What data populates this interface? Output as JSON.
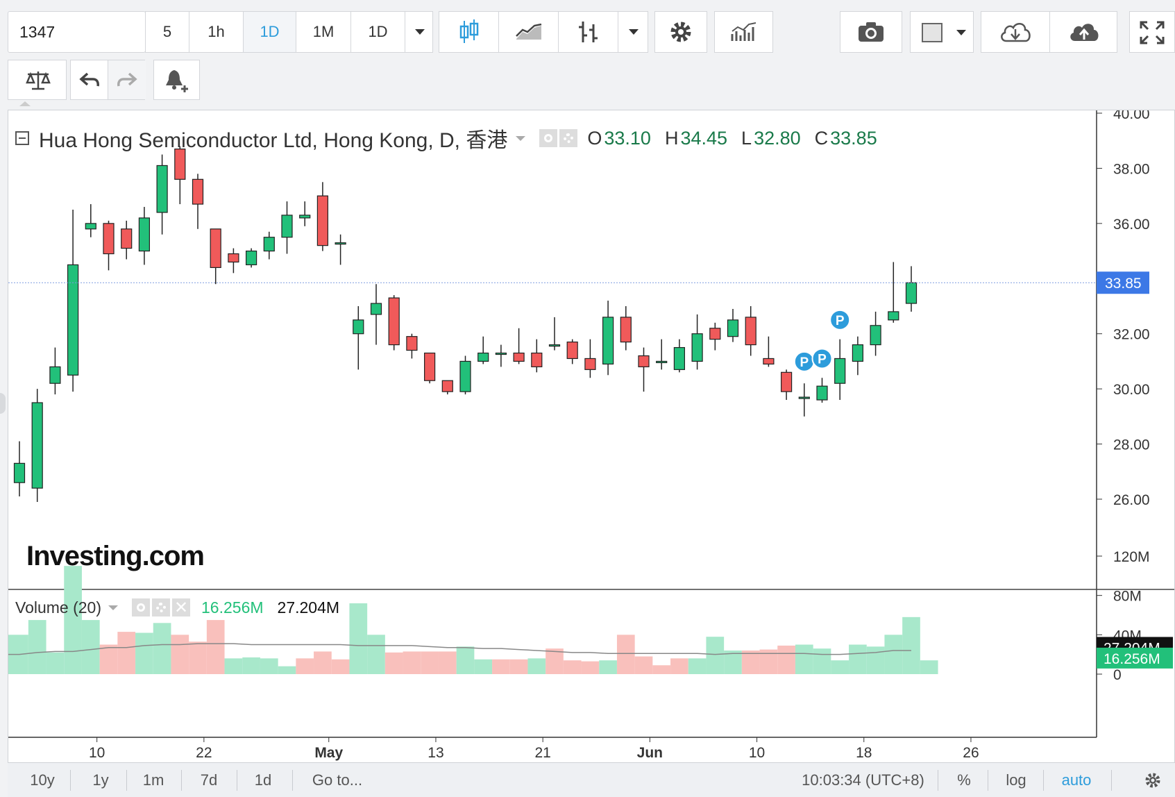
{
  "toolbar": {
    "symbol": "1347",
    "intervals": [
      "5",
      "1h",
      "1D",
      "1M",
      "1D"
    ],
    "active_interval_index": 2
  },
  "legend": {
    "title": "Hua Hong Semiconductor Ltd, Hong Kong, D, 香港",
    "o_label": "O",
    "o_value": "33.10",
    "h_label": "H",
    "h_value": "34.45",
    "l_label": "L",
    "l_value": "32.80",
    "c_label": "C",
    "c_value": "33.85"
  },
  "volume_legend": {
    "label": "Volume (20)",
    "value1": "16.256M",
    "value2": "27.204M"
  },
  "watermark": "Investing.com",
  "bottom": {
    "ranges": [
      "10y",
      "1y",
      "1m",
      "7d",
      "1d"
    ],
    "goto": "Go to...",
    "time": "10:03:34 (UTC+8)",
    "percent": "%",
    "log": "log",
    "auto": "auto"
  },
  "colors": {
    "up": "#22c07a",
    "down": "#f05a5a",
    "vol_up": "#a8e8cb",
    "vol_down": "#f9c0bc",
    "accent": "#2d9cdb",
    "price_badge": "#3c78e6"
  },
  "chart_data": {
    "type": "candlestick",
    "price_axis": {
      "ticks": [
        "40.00",
        "38.00",
        "36.00",
        "34.00",
        "32.00",
        "30.00",
        "28.00",
        "26.00"
      ],
      "ylim": [
        24.3,
        40.4
      ]
    },
    "current_price_label": "33.85",
    "volume_axis": {
      "ticks": [
        "120M",
        "80M",
        "40M",
        "0"
      ],
      "ylim": [
        0,
        125
      ]
    },
    "volume_current_labels": [
      "27.204M",
      "16.256M"
    ],
    "x_labels": [
      "10",
      "22",
      "May",
      "13",
      "21",
      "Jun",
      "10",
      "18",
      "26"
    ],
    "candles": [
      {
        "o": 26.6,
        "h": 28.1,
        "l": 26.1,
        "c": 27.3
      },
      {
        "o": 26.4,
        "h": 30.0,
        "l": 25.9,
        "c": 29.5
      },
      {
        "o": 30.2,
        "h": 31.5,
        "l": 29.8,
        "c": 30.8
      },
      {
        "o": 30.5,
        "h": 36.5,
        "l": 29.9,
        "c": 34.5
      },
      {
        "o": 35.8,
        "h": 36.7,
        "l": 35.5,
        "c": 36.0
      },
      {
        "o": 36.0,
        "h": 36.1,
        "l": 34.3,
        "c": 34.9
      },
      {
        "o": 35.8,
        "h": 36.1,
        "l": 34.7,
        "c": 35.1
      },
      {
        "o": 35.0,
        "h": 36.6,
        "l": 34.5,
        "c": 36.2
      },
      {
        "o": 36.4,
        "h": 38.5,
        "l": 35.6,
        "c": 38.1
      },
      {
        "o": 38.7,
        "h": 38.8,
        "l": 36.7,
        "c": 37.6
      },
      {
        "o": 37.6,
        "h": 37.8,
        "l": 35.8,
        "c": 36.7
      },
      {
        "o": 35.8,
        "h": 35.8,
        "l": 33.8,
        "c": 34.4
      },
      {
        "o": 34.9,
        "h": 35.1,
        "l": 34.2,
        "c": 34.6
      },
      {
        "o": 34.5,
        "h": 35.1,
        "l": 34.4,
        "c": 35.0
      },
      {
        "o": 35.0,
        "h": 35.7,
        "l": 34.7,
        "c": 35.5
      },
      {
        "o": 35.5,
        "h": 36.8,
        "l": 34.9,
        "c": 36.3
      },
      {
        "o": 36.2,
        "h": 36.8,
        "l": 35.9,
        "c": 36.3
      },
      {
        "o": 37.0,
        "h": 37.5,
        "l": 35.0,
        "c": 35.2
      },
      {
        "o": 35.3,
        "h": 35.6,
        "l": 34.5,
        "c": 35.3
      },
      {
        "o": 32.0,
        "h": 33.0,
        "l": 30.7,
        "c": 32.5
      },
      {
        "o": 32.7,
        "h": 33.8,
        "l": 31.6,
        "c": 33.1
      },
      {
        "o": 33.3,
        "h": 33.4,
        "l": 31.4,
        "c": 31.6
      },
      {
        "o": 31.9,
        "h": 32.0,
        "l": 31.1,
        "c": 31.4
      },
      {
        "o": 31.3,
        "h": 31.3,
        "l": 30.2,
        "c": 30.3
      },
      {
        "o": 30.3,
        "h": 30.3,
        "l": 29.8,
        "c": 29.9
      },
      {
        "o": 29.9,
        "h": 31.2,
        "l": 29.8,
        "c": 31.0
      },
      {
        "o": 31.0,
        "h": 31.9,
        "l": 30.9,
        "c": 31.3
      },
      {
        "o": 31.3,
        "h": 31.6,
        "l": 30.8,
        "c": 31.3
      },
      {
        "o": 31.3,
        "h": 32.2,
        "l": 30.9,
        "c": 31.0
      },
      {
        "o": 31.3,
        "h": 31.8,
        "l": 30.6,
        "c": 30.8
      },
      {
        "o": 31.6,
        "h": 32.6,
        "l": 31.4,
        "c": 31.6
      },
      {
        "o": 31.7,
        "h": 31.8,
        "l": 30.9,
        "c": 31.1
      },
      {
        "o": 31.1,
        "h": 31.8,
        "l": 30.4,
        "c": 30.7
      },
      {
        "o": 30.9,
        "h": 33.2,
        "l": 30.5,
        "c": 32.6
      },
      {
        "o": 32.6,
        "h": 33.0,
        "l": 31.4,
        "c": 31.7
      },
      {
        "o": 31.2,
        "h": 31.5,
        "l": 29.9,
        "c": 30.8
      },
      {
        "o": 31.0,
        "h": 31.8,
        "l": 30.7,
        "c": 31.0
      },
      {
        "o": 30.7,
        "h": 31.8,
        "l": 30.6,
        "c": 31.5
      },
      {
        "o": 31.0,
        "h": 32.7,
        "l": 30.7,
        "c": 32.0
      },
      {
        "o": 32.2,
        "h": 32.4,
        "l": 31.4,
        "c": 31.8
      },
      {
        "o": 31.9,
        "h": 32.9,
        "l": 31.7,
        "c": 32.5
      },
      {
        "o": 32.6,
        "h": 33.0,
        "l": 31.2,
        "c": 31.6
      },
      {
        "o": 31.1,
        "h": 31.9,
        "l": 30.8,
        "c": 30.9
      },
      {
        "o": 30.6,
        "h": 30.7,
        "l": 29.6,
        "c": 29.9
      },
      {
        "o": 29.7,
        "h": 30.2,
        "l": 29.0,
        "c": 29.7
      },
      {
        "o": 29.6,
        "h": 30.4,
        "l": 29.5,
        "c": 30.1
      },
      {
        "o": 30.2,
        "h": 31.8,
        "l": 29.6,
        "c": 31.1
      },
      {
        "o": 31.0,
        "h": 31.9,
        "l": 30.5,
        "c": 31.6
      },
      {
        "o": 31.6,
        "h": 32.8,
        "l": 31.2,
        "c": 32.3
      },
      {
        "o": 32.5,
        "h": 34.6,
        "l": 32.4,
        "c": 32.8
      },
      {
        "o": 33.1,
        "h": 34.45,
        "l": 32.8,
        "c": 33.85
      }
    ],
    "volume_up": [
      true,
      true,
      true,
      true,
      true,
      false,
      false,
      true,
      true,
      false,
      false,
      false,
      true,
      true,
      true,
      true,
      false,
      false,
      false,
      true,
      true,
      false,
      false,
      false,
      false,
      true,
      true,
      false,
      false,
      true,
      false,
      false,
      false,
      true,
      false,
      false,
      false,
      false,
      true,
      true,
      true,
      false,
      false,
      false,
      true,
      true,
      true,
      true,
      true,
      true,
      true
    ],
    "volume": [
      40,
      55,
      22,
      110,
      55,
      30,
      43,
      42,
      52,
      40,
      33,
      55,
      16,
      17,
      16,
      8,
      16,
      23,
      15,
      72,
      40,
      22,
      23,
      23,
      23,
      28,
      15,
      15,
      15,
      16,
      26,
      14,
      13,
      14,
      40,
      18,
      9,
      16,
      16,
      38,
      24,
      24,
      25,
      29,
      30,
      26,
      14,
      30,
      28,
      40,
      58,
      14
    ],
    "volume_ma": [
      20,
      22,
      23,
      23,
      25,
      27,
      27,
      29,
      30,
      30,
      31,
      31,
      31,
      30,
      30,
      30,
      30,
      30,
      30,
      29,
      29,
      29,
      29,
      28,
      27,
      27,
      26,
      26,
      25,
      24,
      23,
      22,
      22,
      21,
      21,
      21,
      21,
      21,
      21,
      20,
      21,
      21,
      21,
      21,
      21,
      20,
      20,
      21,
      22,
      24,
      24
    ],
    "markers": [
      {
        "index": 44,
        "price": 30.99,
        "label": "P"
      },
      {
        "index": 45,
        "price": 31.1,
        "label": "P"
      },
      {
        "index": 46,
        "price": 32.5,
        "label": "P"
      }
    ]
  }
}
